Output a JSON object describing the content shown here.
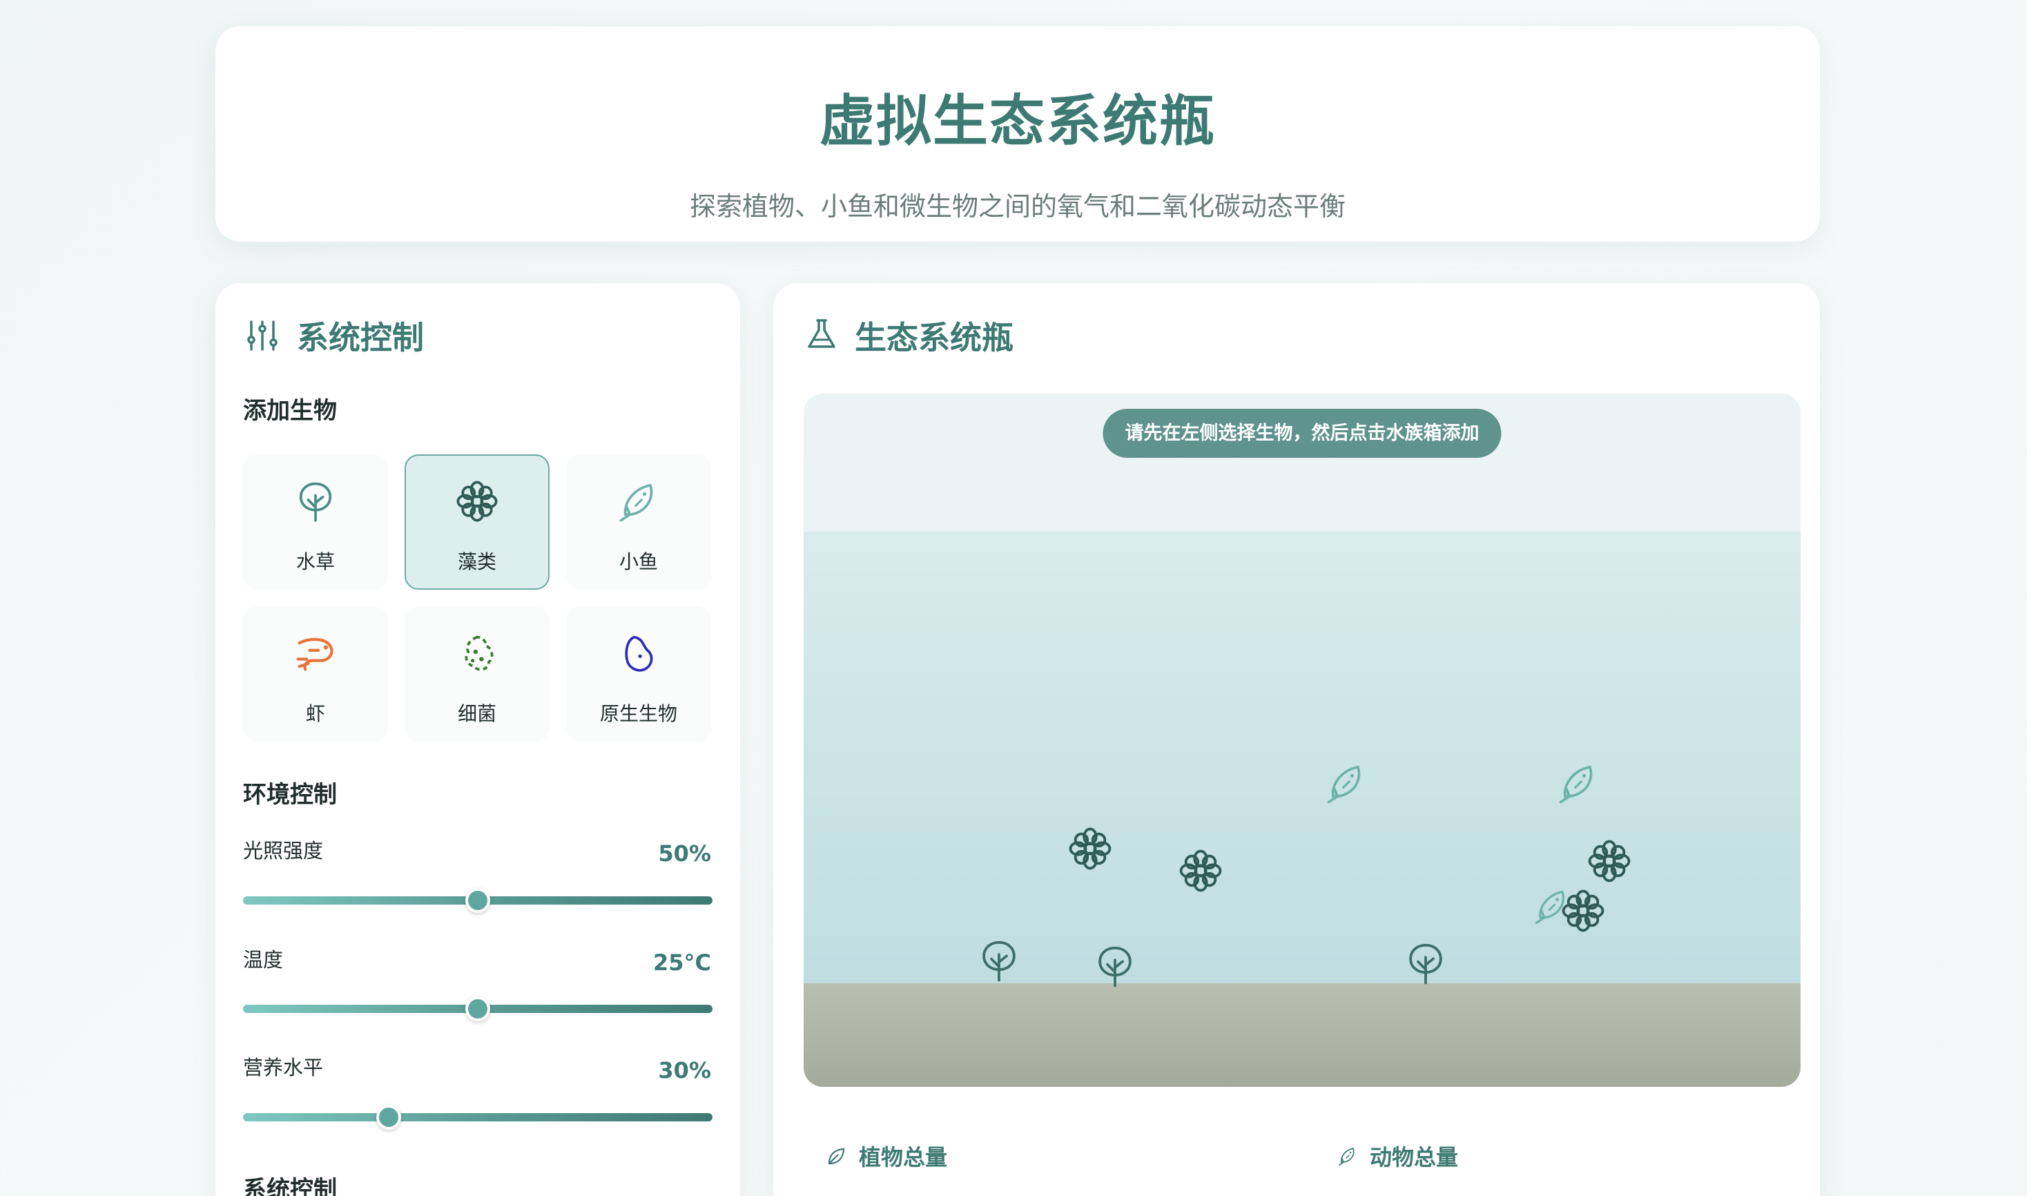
{
  "header": {
    "title": "虚拟生态系统瓶",
    "subtitle": "探索植物、小鱼和微生物之间的氧气和二氧化碳动态平衡"
  },
  "controls": {
    "title": "系统控制",
    "add_section": "添加生物",
    "organisms": [
      {
        "label": "水草",
        "icon": "plant-icon",
        "color": "#4a8c84",
        "selected": false
      },
      {
        "label": "藻类",
        "icon": "flower-icon",
        "color": "#2f5a55",
        "selected": true
      },
      {
        "label": "小鱼",
        "icon": "fish-icon",
        "color": "#6db3aa",
        "selected": false
      },
      {
        "label": "虾",
        "icon": "shrimp-icon",
        "color": "#e8743b",
        "selected": false
      },
      {
        "label": "细菌",
        "icon": "bacteria-icon",
        "color": "#3a7a2e",
        "selected": false
      },
      {
        "label": "原生生物",
        "icon": "protozoa-icon",
        "color": "#2d2fb8",
        "selected": false
      }
    ],
    "env_section": "环境控制",
    "sliders": [
      {
        "label": "光照强度",
        "value": "50%",
        "fraction": 0.5
      },
      {
        "label": "温度",
        "value": "25°C",
        "fraction": 0.5
      },
      {
        "label": "营养水平",
        "value": "30%",
        "fraction": 0.31
      }
    ],
    "system_section": "系统控制"
  },
  "bottle": {
    "title": "生态系统瓶",
    "hint": "请先在左侧选择生物，然后点击水族箱添加",
    "stats": [
      {
        "label": "植物总量",
        "icon": "leaf-icon"
      },
      {
        "label": "动物总量",
        "icon": "fish-icon"
      }
    ]
  },
  "colors": {
    "accent": "#3d7a73",
    "water": "#c9e3e5",
    "sand": "#a5ab9c",
    "hint_bg": "#5f938e"
  }
}
